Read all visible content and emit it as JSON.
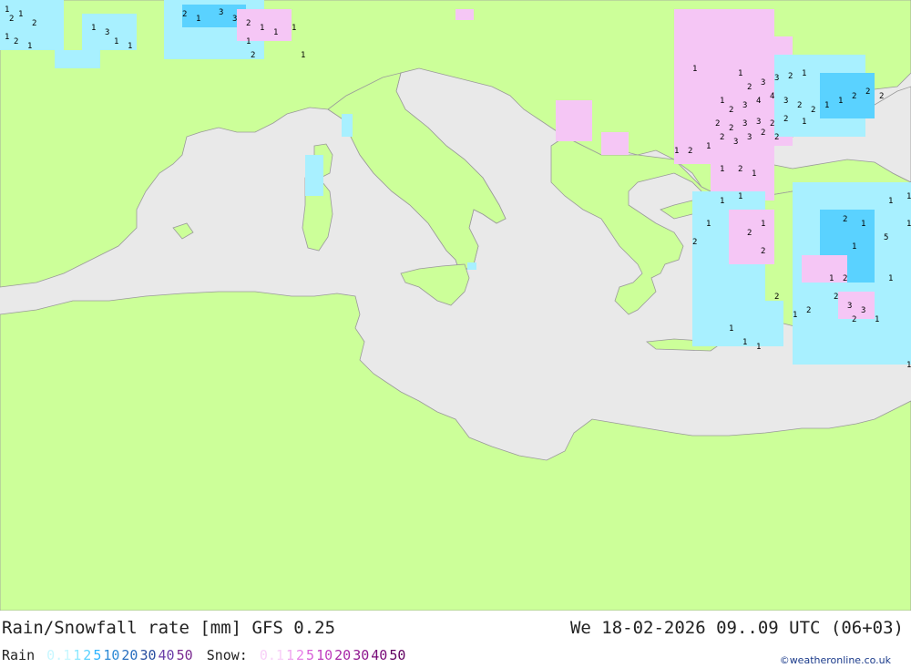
{
  "map": {
    "region": "Mediterranean",
    "colors": {
      "sea": "#e9e9e9",
      "land": "#ccff99",
      "border": "#9a9a9a",
      "rain_light": "#a8f0ff",
      "rain_mid": "#5ad2ff",
      "snow": "#f5c6f5",
      "label": "#000000"
    }
  },
  "footer": {
    "title": "Rain/Snowfall rate [mm] GFS 0.25",
    "valid_time": "We 18-02-2026 09..09 UTC (06+03)",
    "legend": {
      "rain_label": "Rain",
      "rain_values": [
        "0.1",
        "1",
        "2",
        "5",
        "10",
        "20",
        "30",
        "40",
        "50"
      ],
      "rain_colors": [
        "#c8f7ff",
        "#8ee8ff",
        "#5ad2ff",
        "#2fb4ff",
        "#2e8bd6",
        "#2a6fbf",
        "#2a4fa0",
        "#6a3da8",
        "#7a2a90"
      ],
      "snow_label": "Snow:",
      "snow_values": [
        "0.1",
        "1",
        "2",
        "5",
        "10",
        "20",
        "30",
        "40",
        "50"
      ],
      "snow_colors": [
        "#f8d0f8",
        "#f0a8f0",
        "#e880e8",
        "#d860d8",
        "#c040c0",
        "#a828a8",
        "#901890",
        "#780c78",
        "#600060"
      ]
    },
    "credit": "©weatheronline.co.uk"
  }
}
